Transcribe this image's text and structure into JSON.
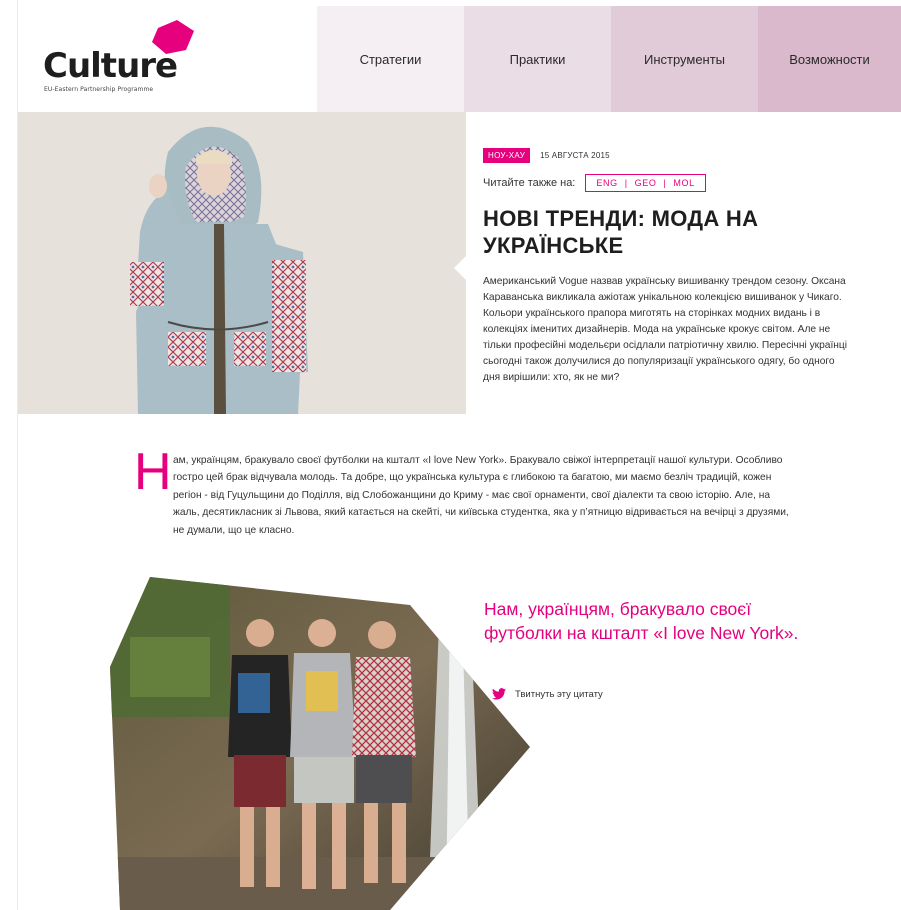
{
  "logo": {
    "word": "Culture",
    "subtitle": "EU-Eastern Partnership Programme",
    "accent": "#e6007e"
  },
  "nav": {
    "items": [
      {
        "label": "Стратегии",
        "bg": "#f5eef2"
      },
      {
        "label": "Практики",
        "bg": "#ebdde5"
      },
      {
        "label": "Инструменты",
        "bg": "#e2cbd8"
      },
      {
        "label": "Возможности",
        "bg": "#d9b9cb"
      }
    ]
  },
  "article": {
    "tag": "НОУ-ХАУ",
    "date": "15 АВГУСТА 2015",
    "read_also_label": "Читайте также на:",
    "languages": [
      "ENG",
      "GEO",
      "MOL"
    ],
    "title": "НОВІ ТРЕНДИ: МОДА НА УКРАЇНСЬКЕ",
    "intro": "Американський Vogue назвав українську вишиванку трендом сезону. Оксана Караванська викликала ажіотаж унікальною колекцією вишиванок у Чикаго. Кольори українського прапора миготять на сторінках модних видань і в колекціях іменитих дизайнерів. Мода на українське крокує світом. Але не тільки професійні модельєри осідлали патріотичну хвилю. Пересічні українці сьогодні також долучилися до популяризації українського одягу, бо одного дня вирішили: хто, як не ми?",
    "dropcap": "Н",
    "body": "ам, українцям, бракувало своєї футболки на кшталт «I love New York». Бракувало свіжої інтерпретації нашої культури. Особливо гостро цей брак відчувала молодь. Та добре, що українська культура є глибокою та багатою, ми маємо безліч традицій, кожен регіон - від Гуцульщини до Поділля, від Слобожанщини до Криму - має свої орнаменти, свої діалекти та свою історію. Але, на жаль, десятикласник зі Львова, який катається на скейті, чи київська студентка, яка у п’ятницю відривається на вечірці з друзями, не думали, що це класно.",
    "quote": "Нам, українцям, бракувало своєї футболки на кшталт «I love New York».",
    "tweet_label": "Твитнуть эту цитату"
  },
  "colors": {
    "accent": "#e6007e",
    "text": "#333333",
    "twitter": "#e6007e"
  },
  "icons": {
    "logo": "hexagon-logo-icon",
    "tweet": "twitter-bird-icon"
  }
}
